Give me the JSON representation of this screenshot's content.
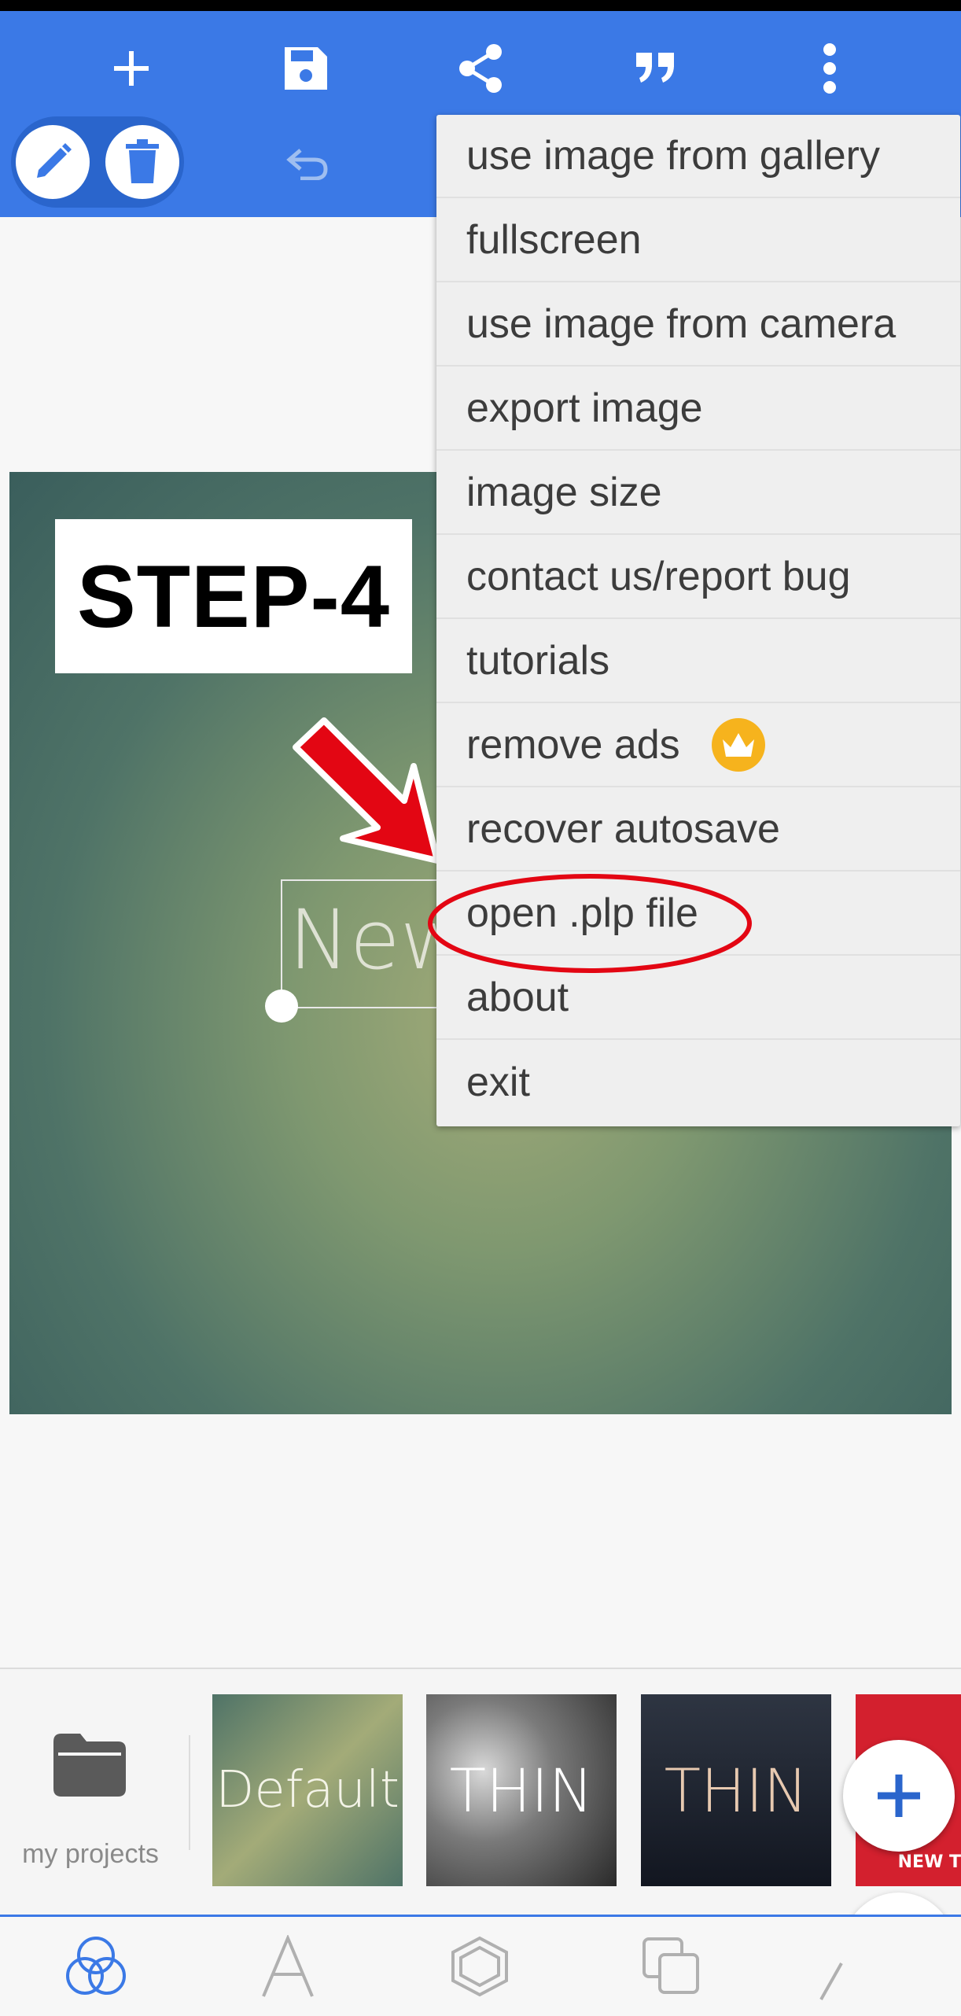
{
  "toolbar": {
    "icons": [
      "add-icon",
      "save-icon",
      "share-icon",
      "quote-icon",
      "more-vert-icon",
      "edit-icon",
      "delete-icon",
      "undo-icon"
    ],
    "accent": "#3b79e6"
  },
  "canvas": {
    "step_label": "STEP-4",
    "text_layer": "New"
  },
  "menu": {
    "items": [
      {
        "label": "use image from gallery"
      },
      {
        "label": "fullscreen"
      },
      {
        "label": "use image from camera"
      },
      {
        "label": "export image"
      },
      {
        "label": "image size"
      },
      {
        "label": "contact us/report bug"
      },
      {
        "label": "tutorials"
      },
      {
        "label": "remove ads"
      },
      {
        "label": "recover autosave"
      },
      {
        "label": "open .plp file"
      },
      {
        "label": "about"
      },
      {
        "label": "exit"
      }
    ],
    "highlight_color": "#e30613"
  },
  "templates": {
    "my_projects_label": "my projects",
    "items": [
      {
        "label": "Default"
      },
      {
        "label": "THIN"
      },
      {
        "label": "THIN"
      },
      {
        "label": "NEW T"
      }
    ]
  },
  "bottom_nav": {
    "tabs": [
      "blend-icon",
      "text-icon",
      "shape-icon",
      "layers-icon",
      "draw-icon"
    ]
  }
}
